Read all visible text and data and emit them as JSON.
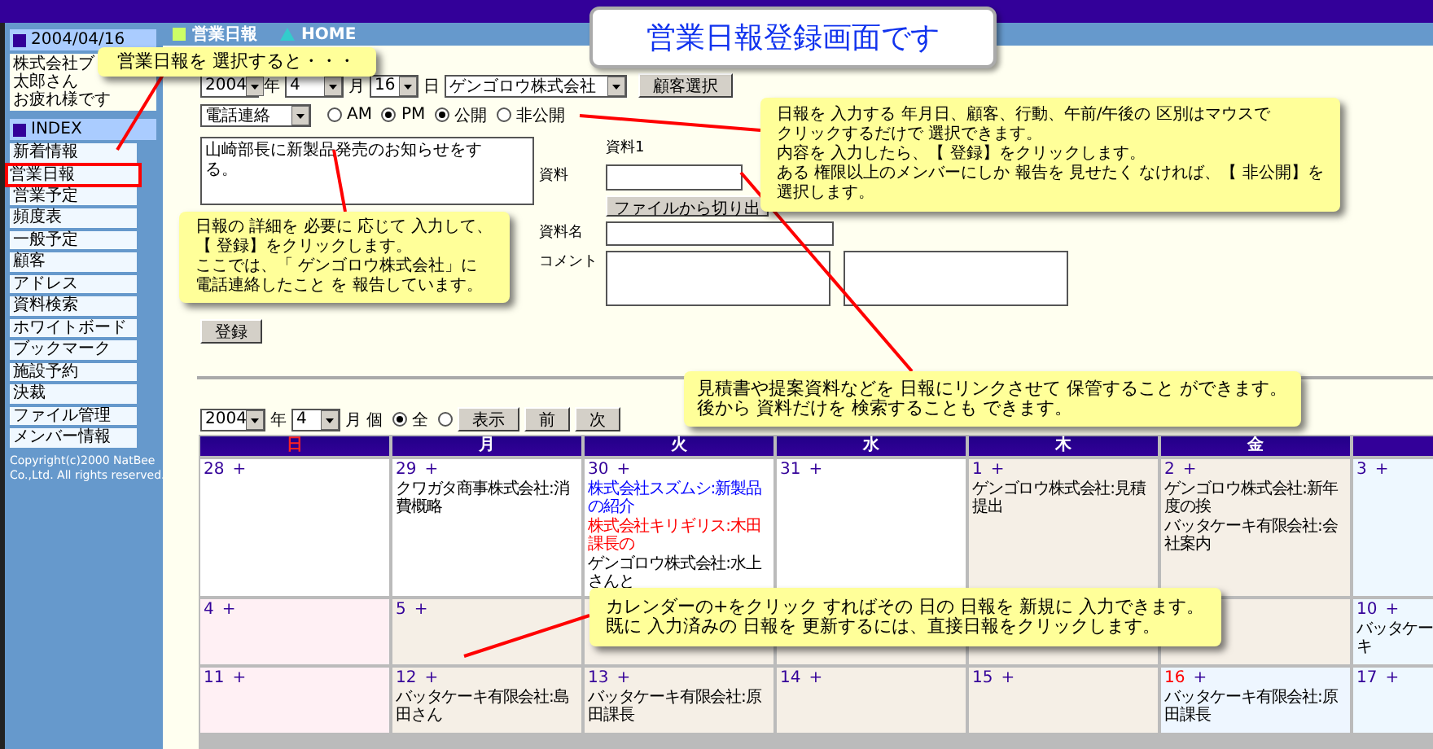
{
  "title_banner": "営業日報登録画面です",
  "nav": {
    "section": "営業日報",
    "home": "HOME"
  },
  "sidebar": {
    "date": "2004/04/16",
    "user_lines": [
      "株式会社ブ",
      "太郎さん",
      "お疲れ様です"
    ],
    "index_title": "INDEX",
    "items": [
      {
        "label": "新着情報",
        "highlighted": false
      },
      {
        "label": "営業日報",
        "highlighted": true
      },
      {
        "label": "営業予定",
        "highlighted": false
      },
      {
        "label": "頻度表",
        "highlighted": false
      },
      {
        "label": "一般予定",
        "highlighted": false
      },
      {
        "label": "顧客",
        "highlighted": false
      },
      {
        "label": "アドレス",
        "highlighted": false
      },
      {
        "label": "資料検索",
        "highlighted": false
      },
      {
        "label": "ホワイトボード",
        "highlighted": false
      },
      {
        "label": "ブックマーク",
        "highlighted": false
      },
      {
        "label": "施設予約",
        "highlighted": false
      },
      {
        "label": "決裁",
        "highlighted": false
      },
      {
        "label": "ファイル管理",
        "highlighted": false
      },
      {
        "label": "メンバー情報",
        "highlighted": false
      }
    ],
    "copyright": [
      "Copyright(c)2000 NatBee",
      "Co.,Ltd. All rights reserved."
    ]
  },
  "form": {
    "year": "2004",
    "year_unit": "年",
    "month": "4",
    "month_unit": "月",
    "day": "16",
    "day_unit": "日",
    "customer": "ゲンゴロウ株式会社",
    "customer_button": "顧客選択",
    "action": "電話連絡",
    "time_of_day": [
      {
        "label": "AM",
        "selected": false
      },
      {
        "label": "PM",
        "selected": true
      }
    ],
    "visibility": [
      {
        "label": "公開",
        "selected": true
      },
      {
        "label": "非公開",
        "selected": false
      }
    ],
    "report_text": "山崎部長に新製品発売のお知らせをする。",
    "attachment_heading": "資料1",
    "attachment_label": "資料",
    "extract_button": "ファイルから切り出",
    "name_label": "資料名",
    "comment_label": "コメント",
    "submit_button": "登録"
  },
  "calendar": {
    "year": "2004",
    "year_unit": "年",
    "month": "4",
    "month_unit": "月",
    "scope": [
      {
        "label": "個",
        "selected": true
      },
      {
        "label": "全",
        "selected": false
      }
    ],
    "buttons": [
      "表示",
      "前",
      "次"
    ],
    "weekdays": [
      {
        "label": "日",
        "kind": "sunday"
      },
      {
        "label": "月",
        "kind": "weekday"
      },
      {
        "label": "火",
        "kind": "weekday"
      },
      {
        "label": "水",
        "kind": "weekday"
      },
      {
        "label": "木",
        "kind": "weekday"
      },
      {
        "label": "金",
        "kind": "weekday"
      }
    ],
    "weeks": [
      [
        {
          "day": "28",
          "plus": "+",
          "kind": "other"
        },
        {
          "day": "29",
          "plus": "+",
          "kind": "other",
          "entries": [
            {
              "text": "クワガタ商事株式会社:消費概略",
              "color": "#000000"
            }
          ]
        },
        {
          "day": "30",
          "plus": "+",
          "kind": "other",
          "entries": [
            {
              "text": "株式会社スズムシ:新製品の紹介",
              "color": "#0000ff"
            },
            {
              "text": "株式会社キリギリス:木田課長の",
              "color": "#ff0000"
            },
            {
              "text": "ゲンゴロウ株式会社:水上さんと",
              "color": "#000000"
            }
          ]
        },
        {
          "day": "31",
          "plus": "+",
          "kind": "other"
        },
        {
          "day": "1",
          "plus": "+",
          "kind": "weekday",
          "entries": [
            {
              "text": "ゲンゴロウ株式会社:見積提出",
              "color": "#000000"
            }
          ]
        },
        {
          "day": "2",
          "plus": "+",
          "kind": "weekday",
          "entries": [
            {
              "text": "ゲンゴロウ株式会社:新年度の挨",
              "color": "#000000"
            },
            {
              "text": "バッタケーキ有限会社:会社案内",
              "color": "#000000"
            }
          ]
        },
        {
          "day": "3",
          "plus": "+",
          "kind": "saturday"
        }
      ],
      [
        {
          "day": "4",
          "plus": "+",
          "kind": "sunday"
        },
        {
          "day": "5",
          "plus": "+",
          "kind": "weekday"
        },
        {
          "kind": "weekday"
        },
        {
          "kind": "weekday"
        },
        {
          "kind": "weekday"
        },
        {
          "kind": "weekday"
        },
        {
          "day": "10",
          "plus": "+",
          "kind": "saturday",
          "entries": [
            {
              "text": "バッタケーキ",
              "color": "#000000"
            }
          ]
        }
      ],
      [
        {
          "day": "11",
          "plus": "+",
          "kind": "sunday"
        },
        {
          "day": "12",
          "plus": "+",
          "kind": "weekday",
          "entries": [
            {
              "text": "バッタケーキ有限会社:島田さん",
              "color": "#000000"
            }
          ]
        },
        {
          "day": "13",
          "plus": "+",
          "kind": "weekday",
          "entries": [
            {
              "text": "バッタケーキ有限会社:原田課長",
              "color": "#000000"
            }
          ]
        },
        {
          "day": "14",
          "plus": "+",
          "kind": "weekday"
        },
        {
          "day": "15",
          "plus": "+",
          "kind": "weekday"
        },
        {
          "day": "16",
          "plus": "+",
          "kind": "today",
          "entries": [
            {
              "text": "バッタケーキ有限会社:原田課長",
              "color": "#000000"
            }
          ]
        },
        {
          "day": "17",
          "plus": "+",
          "kind": "saturday"
        }
      ]
    ]
  },
  "callouts": [
    {
      "lines": [
        "営業日報を 選択すると・・・"
      ]
    },
    {
      "lines": [
        "日報の 詳細を 必要に 応じて 入力して、",
        "【 登録】をクリックします。",
        "ここでは、「 ゲンゴロウ株式会社」に",
        "電話連絡したこと を 報告しています。"
      ]
    },
    {
      "lines": [
        "日報を 入力する 年月日、顧客、行動、午前/午後の 区別はマウスで",
        "クリックするだけで 選択できます。",
        "内容を 入力したら、【 登録】をクリックします。",
        "ある 権限以上のメンバーにしか 報告を 見せたく なければ、【 非公開】を",
        "選択します。"
      ]
    },
    {
      "lines": [
        "見積書や提案資料などを 日報にリンクさせて 保管すること ができます。",
        "後から 資料だけを 検索することも できます。"
      ]
    },
    {
      "lines": [
        "カレンダーの+をクリック すればその 日の 日報を 新規に 入力できます。",
        "既に 入力済みの 日報を 更新するには、直接日報をクリックします。"
      ]
    }
  ]
}
